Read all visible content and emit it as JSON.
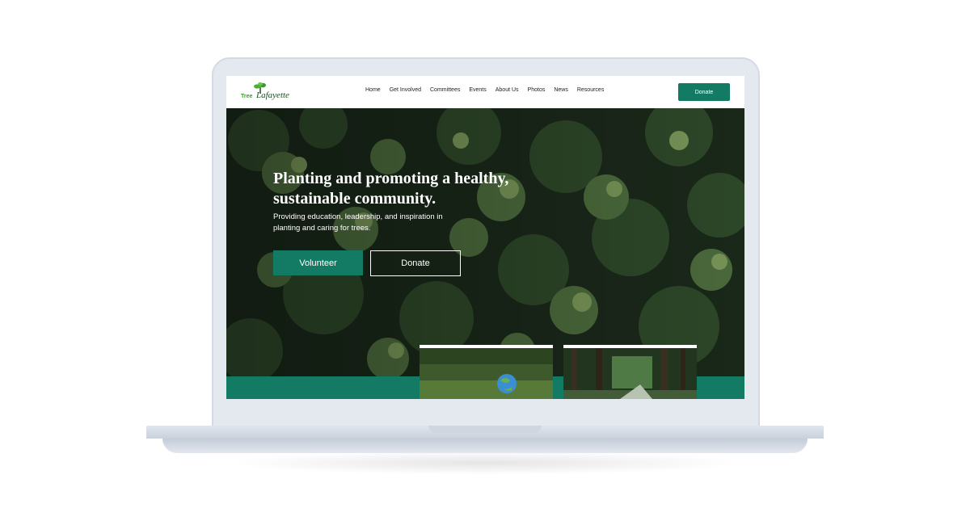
{
  "brand": {
    "tree": "Tree",
    "name": "Lafayette"
  },
  "nav": {
    "links": [
      "Home",
      "Get Involved",
      "Committees",
      "Events",
      "About Us",
      "Photos",
      "News",
      "Resources"
    ],
    "donate_label": "Donate"
  },
  "hero": {
    "title": "Planting and promoting a healthy, sustainable community.",
    "subtitle": "Providing education, leadership, and inspiration in planting and caring for trees.",
    "volunteer_label": "Volunteer",
    "donate_label": "Donate"
  },
  "colors": {
    "accent": "#137a63",
    "logo_green": "#3c9a2f"
  },
  "icons": {
    "logo": "tree-logo-icon"
  }
}
